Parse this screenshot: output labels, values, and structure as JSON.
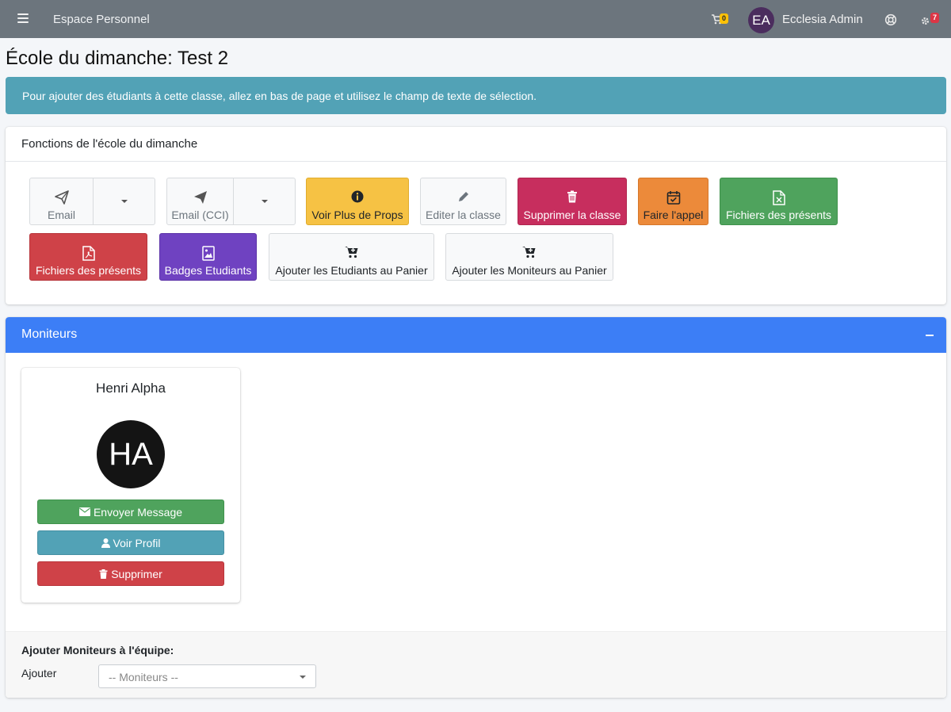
{
  "navbar": {
    "brand": "Espace Personnel",
    "cart_count": "0",
    "user_initials": "EA",
    "user_name": "Ecclesia Admin",
    "notifications_count": "7"
  },
  "page": {
    "title": "École du dimanche: Test 2"
  },
  "alert": {
    "text": "Pour ajouter des étudiants à cette classe, allez en bas de page et utilisez le champ de texte de sélection."
  },
  "functions": {
    "header": "Fonctions de l'école du dimanche",
    "buttons": {
      "email": "Email",
      "email_cci": "Email (CCI)",
      "voir_plus": "Voir Plus de Props",
      "editer": "Editer la classe",
      "supprimer": "Supprimer la classe",
      "appel": "Faire l'appel",
      "fichiers_excel": "Fichiers des présents",
      "fichiers_pdf": "Fichiers des présents",
      "badges": "Badges Etudiants",
      "panier_etudiants": "Ajouter les Etudiants au Panier",
      "panier_moniteurs": "Ajouter les Moniteurs au Panier"
    }
  },
  "moniteurs": {
    "header": "Moniteurs",
    "person": {
      "name": "Henri Alpha",
      "initials": "HA",
      "send_message": "Envoyer Message",
      "view_profile": "Voir Profil",
      "delete": "Supprimer"
    },
    "add": {
      "title": "Ajouter Moniteurs à l'équipe:",
      "label": "Ajouter",
      "select_placeholder": "-- Moniteurs --"
    }
  },
  "colors": {
    "navbar": "#6c757d",
    "alert": "#52a2b6",
    "moniteurs_header": "#3c7ef6",
    "warning": "#f6c244",
    "danger": "#cf4248",
    "success": "#4fa35d",
    "purple": "#6f42c1",
    "crimson": "#c72e5e",
    "orange": "#ec8a3a"
  }
}
